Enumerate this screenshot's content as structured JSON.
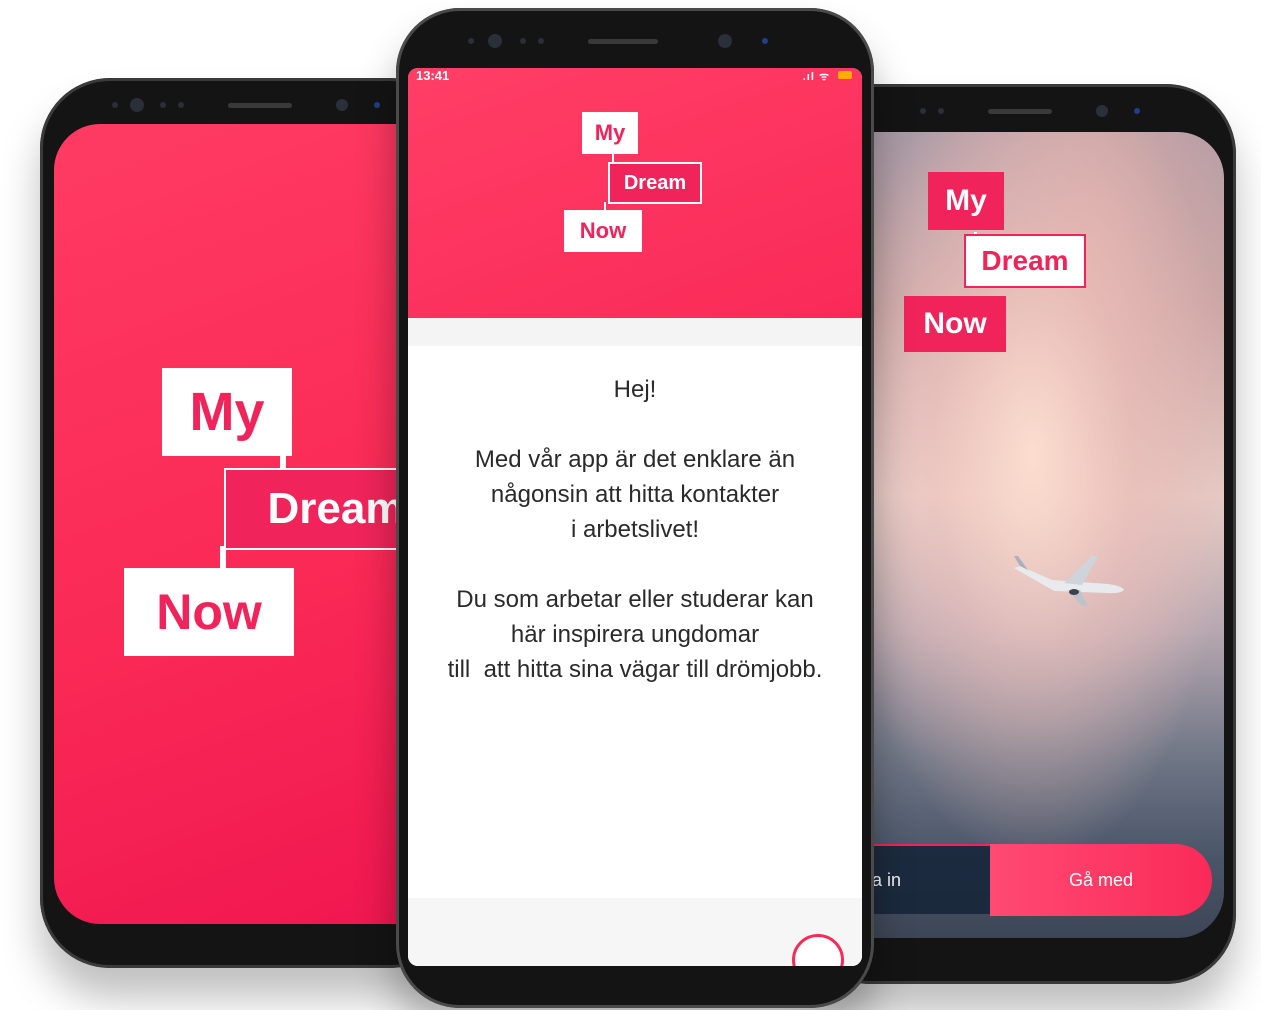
{
  "brand": {
    "logo_words": [
      "My",
      "Dream",
      "Now"
    ],
    "primary_color": "#fa2a58",
    "accent_color": "#f0245a"
  },
  "center_screen": {
    "status": {
      "time": "13:41",
      "signal": ".ıl ᯤ"
    },
    "greeting": "Hej!",
    "paragraph1_lines": [
      "Med vår app är det enklare än",
      "någonsin att hitta kontakter",
      "i arbetslivet!"
    ],
    "paragraph2_lines": [
      "Du som arbetar eller studerar kan",
      "här inspirera ungdomar",
      "till  att hitta sina vägar till drömjobb."
    ]
  },
  "right_screen": {
    "login_label": "ga in",
    "join_label": "Gå med"
  }
}
